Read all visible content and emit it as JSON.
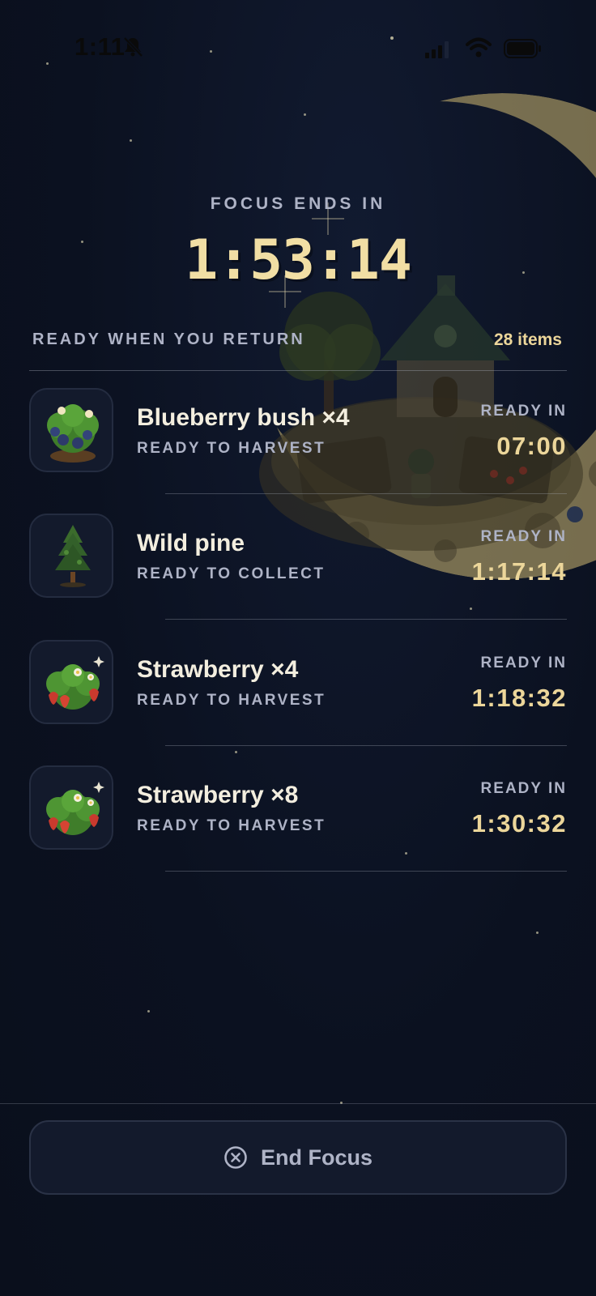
{
  "status_bar": {
    "time": "1:11",
    "icons": [
      "bell-slash-icon",
      "signal-icon",
      "wifi-icon",
      "battery-icon"
    ]
  },
  "focus": {
    "label": "FOCUS ENDS IN",
    "remaining": "1:53:14"
  },
  "section": {
    "title": "READY WHEN YOU RETURN",
    "count": "28 items"
  },
  "items": [
    {
      "name": "Blueberry bush ×4",
      "status": "READY TO HARVEST",
      "ready_label": "READY IN",
      "timer": "07:00",
      "icon": "blueberry-bush-icon"
    },
    {
      "name": "Wild pine",
      "status": "READY TO COLLECT",
      "ready_label": "READY IN",
      "timer": "1:17:14",
      "icon": "pine-tree-icon"
    },
    {
      "name": "Strawberry ×4",
      "status": "READY TO HARVEST",
      "ready_label": "READY IN",
      "timer": "1:18:32",
      "icon": "strawberry-plant-icon"
    },
    {
      "name": "Strawberry ×8",
      "status": "READY TO HARVEST",
      "ready_label": "READY IN",
      "timer": "1:30:32",
      "icon": "strawberry-plant-icon"
    }
  ],
  "footer": {
    "end_button_label": "End Focus",
    "end_button_icon": "close-circle-icon"
  },
  "colors": {
    "background": "#0b1120",
    "accent_gold": "#ecd69a",
    "muted_text": "#aeb3c6",
    "primary_text": "#f3eedf"
  }
}
